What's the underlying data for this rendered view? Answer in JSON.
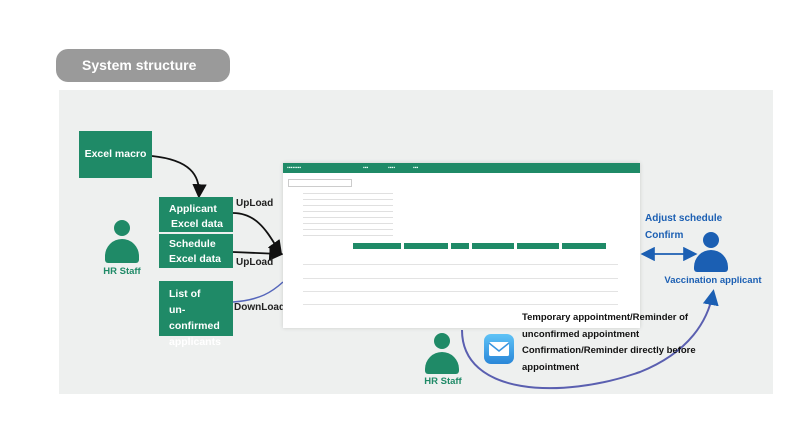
{
  "title": "System structure",
  "excel_macro": "Excel macro",
  "boxes": {
    "applicant": [
      "Applicant",
      "Excel data"
    ],
    "schedule": [
      "Schedule",
      "Excel data"
    ],
    "unconfirmed": [
      "List of",
      "un-confirmed",
      "applicants"
    ]
  },
  "arrows": {
    "upload1": "UpLoad",
    "upload2": "UpLoad",
    "download": "DownLoad"
  },
  "people": {
    "hr_left": "HR Staff",
    "hr_bottom": "HR Staff",
    "applicant": "Vaccination applicant"
  },
  "adjust": [
    "Adjust schedule",
    "Confirm"
  ],
  "notifications": [
    "Temporary appointment/Reminder of",
    "unconfirmed appointment",
    "Confirmation/Reminder directly before",
    "appointment"
  ],
  "colors": {
    "green": "#1f8a67",
    "blue": "#1b5fb3",
    "pill": "#9a9a9a",
    "panel": "#eef0ef"
  },
  "icons": [
    "person-icon",
    "mail-icon"
  ]
}
